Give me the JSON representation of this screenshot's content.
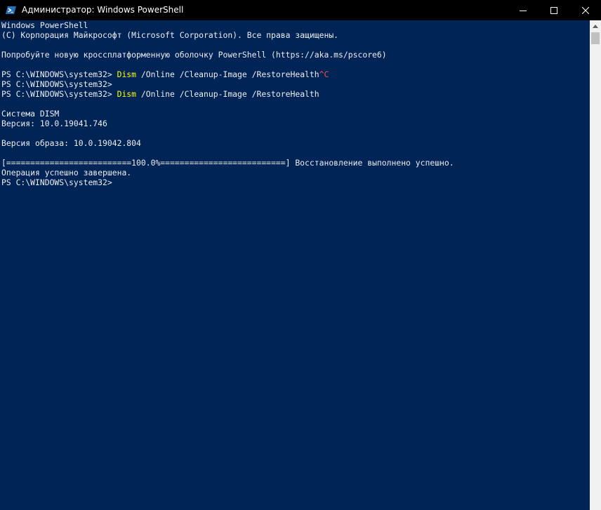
{
  "window": {
    "title": "Администратор: Windows PowerShell"
  },
  "colors": {
    "background": "#012456",
    "text": "#eeedf0",
    "command": "#ffff00",
    "interrupt": "#ff4d4d",
    "titlebar": "#000000"
  },
  "icons": {
    "app": "powershell-icon",
    "minimize": "minimize-icon",
    "maximize": "maximize-icon",
    "close": "close-icon",
    "scroll_up": "scroll-up-arrow-icon"
  },
  "console": {
    "banner1": "Windows PowerShell",
    "banner2": "(C) Корпорация Майкрософт (Microsoft Corporation). Все права защищены.",
    "tip": "Попробуйте новую кроссплатформенную оболочку PowerShell (https://aka.ms/pscore6)",
    "prompt": "PS C:\\WINDOWS\\system32>",
    "cmd_name": "Dism",
    "cmd_args": " /Online /Cleanup-Image /RestoreHealth",
    "interrupt": "^C",
    "dism_title": "Система DISM",
    "dism_version": "Версия: 10.0.19041.746",
    "image_version": "Версия образа: 10.0.19042.804",
    "progress": "[==========================100.0%==========================] Восстановление выполнено успешно.",
    "done": "Операция успешно завершена."
  }
}
